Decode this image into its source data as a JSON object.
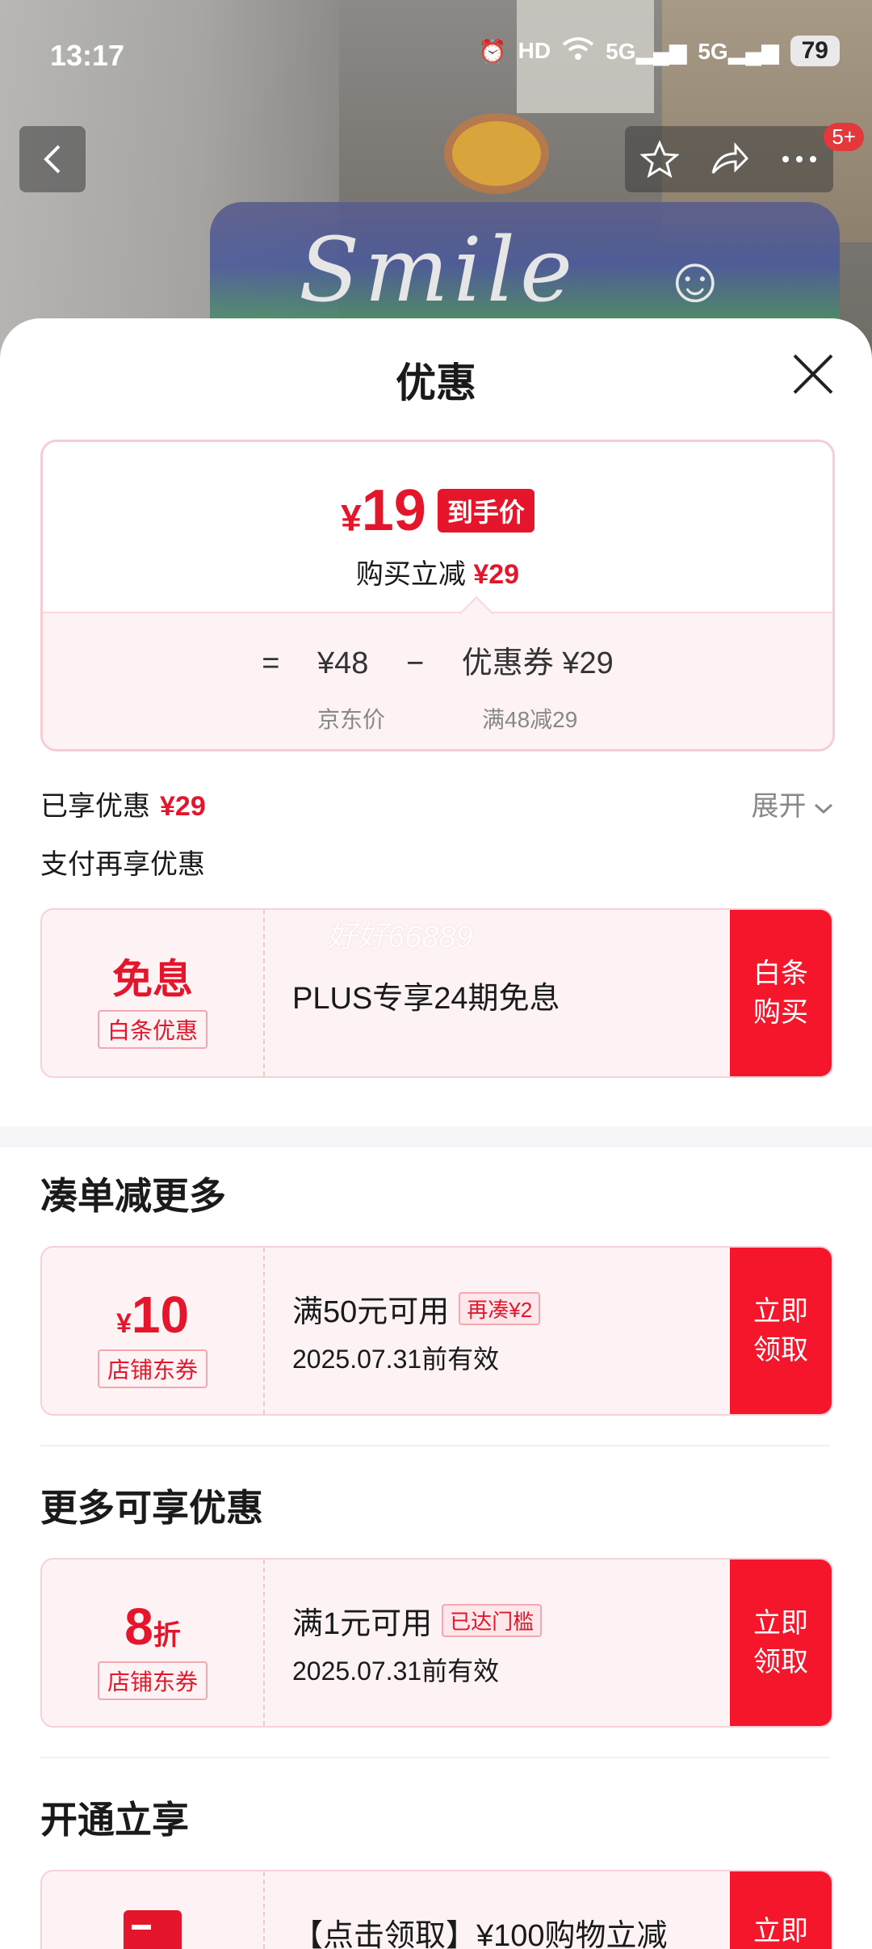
{
  "status_bar": {
    "time": "13:17",
    "battery": "79",
    "hd": "HD",
    "net1": "5G",
    "net2": "5G"
  },
  "background": {
    "text": "Smile"
  },
  "nav": {
    "badge": "5+"
  },
  "sheet": {
    "title": "优惠",
    "price_card": {
      "currency": "¥",
      "price": "19",
      "tag": "到手价",
      "reduce_label": "购买立减",
      "reduce_value": "¥29",
      "equals": "=",
      "jd_price": "¥48",
      "minus": "−",
      "coupon_value": "优惠券 ¥29",
      "jd_price_label": "京东价",
      "coupon_rule": "满48减29"
    },
    "enjoyed_label": "已享优惠",
    "enjoyed_value": "¥29",
    "expand_label": "展开",
    "pay_more_label": "支付再享优惠",
    "watermark": "好好66889",
    "baitiao": {
      "main": "免息",
      "sub": "白条优惠",
      "desc": "PLUS专享24期免息",
      "action": "白条购买"
    },
    "section1_title": "凑单减更多",
    "coupon1": {
      "currency": "¥",
      "amount": "10",
      "sub": "店铺东券",
      "condition": "满50元可用",
      "pill": "再凑¥2",
      "valid": "2025.07.31前有效",
      "action": "立即领取"
    },
    "section2_title": "更多可享优惠",
    "coupon2": {
      "amount": "8",
      "unit": "折",
      "sub": "店铺东券",
      "condition": "满1元可用",
      "pill": "已达门槛",
      "valid": "2025.07.31前有效",
      "action": "立即领取"
    },
    "section3_title": "开通立享",
    "coupon3": {
      "desc": "【点击领取】¥100购物立减",
      "action": "立即"
    }
  },
  "colors": {
    "accent": "#e5162b",
    "card_bg": "#fdf3f4",
    "border": "#f6cdd2"
  }
}
